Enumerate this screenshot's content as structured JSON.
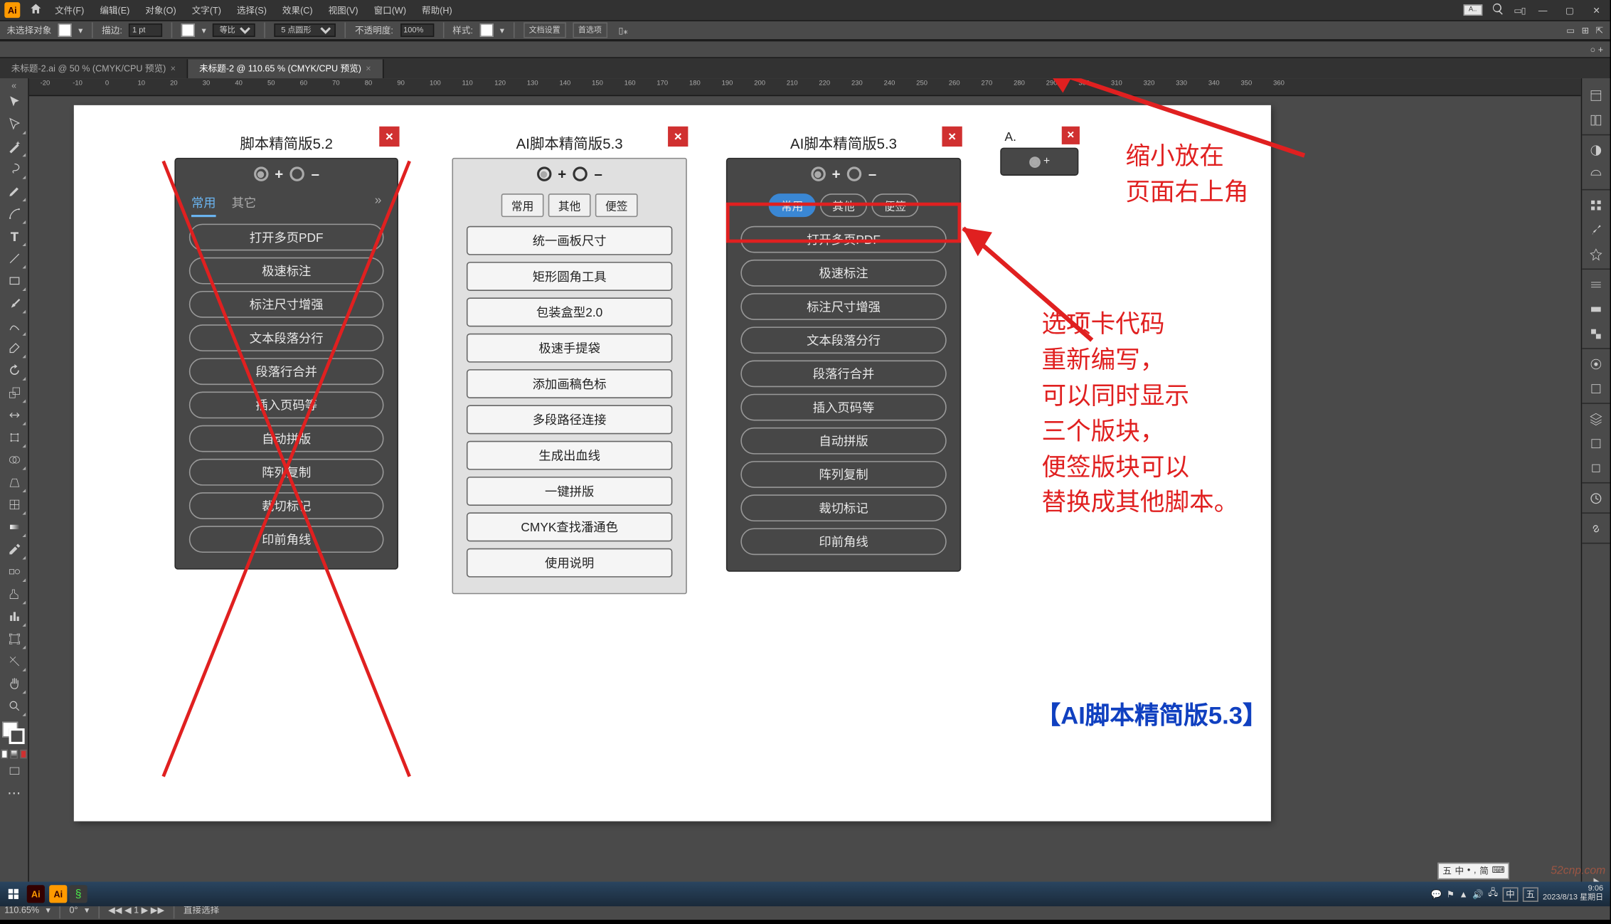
{
  "menu": [
    "文件(F)",
    "编辑(E)",
    "对象(O)",
    "文字(T)",
    "选择(S)",
    "效果(C)",
    "视图(V)",
    "窗口(W)",
    "帮助(H)"
  ],
  "titleMini": "A..",
  "control": {
    "noSelection": "未选择对象",
    "stroke": "描边:",
    "strokeVal": "1 pt",
    "uniform": "等比",
    "dots": "5 点圆形",
    "opacity": "不透明度:",
    "opacityVal": "100%",
    "style": "样式:",
    "docSetup": "文档设置",
    "prefs": "首选项"
  },
  "tabs": [
    {
      "label": "未标题-2.ai @ 50 % (CMYK/CPU 预览)",
      "active": false
    },
    {
      "label": "未标题-2 @ 110.65 % (CMYK/CPU 预览)",
      "active": true
    }
  ],
  "rulerMarks": [
    -20,
    -10,
    0,
    10,
    20,
    30,
    40,
    50,
    60,
    70,
    80,
    90,
    100,
    110,
    120,
    130,
    140,
    150,
    160,
    170,
    180,
    190,
    200,
    210,
    220,
    230,
    240,
    250,
    260,
    270,
    280,
    290,
    300,
    310,
    320,
    330,
    340,
    350,
    360
  ],
  "panel1": {
    "title": "脚本精简版5.2",
    "tabs": [
      "常用",
      "其它"
    ],
    "buttons": [
      "打开多页PDF",
      "极速标注",
      "标注尺寸增强",
      "文本段落分行",
      "段落行合并",
      "插入页码等",
      "自动拼版",
      "阵列复制",
      "裁切标记",
      "印前角线"
    ]
  },
  "panel2": {
    "title": "AI脚本精简版5.3",
    "tabs": [
      "常用",
      "其他",
      "便签"
    ],
    "buttons": [
      "统一画板尺寸",
      "矩形圆角工具",
      "包装盒型2.0",
      "极速手提袋",
      "添加画稿色标",
      "多段路径连接",
      "生成出血线",
      "一键拼版",
      "CMYK查找潘通色",
      "使用说明"
    ]
  },
  "panel3": {
    "title": "AI脚本精简版5.3",
    "tabs": [
      "常用",
      "其他",
      "便签"
    ],
    "buttons": [
      "打开多页PDF",
      "极速标注",
      "标注尺寸增强",
      "文本段落分行",
      "段落行合并",
      "插入页码等",
      "自动拼版",
      "阵列复制",
      "裁切标记",
      "印前角线"
    ]
  },
  "panel4": {
    "title": "A."
  },
  "anno1": "缩小放在\n页面右上角",
  "anno2": "选项卡代码\n重新编写，\n可以同时显示\n三个版块，\n便签版块可以\n替换成其他脚本。",
  "anno3": "【AI脚本精简版5.3】",
  "status": {
    "zoom": "110.65%",
    "rot": "0°",
    "nav": "1",
    "tool": "直接选择"
  },
  "ime": [
    "五",
    "中",
    "•",
    ",",
    "简",
    "⌨"
  ],
  "taskbar": {
    "time": "9:06",
    "date": "2023/8/13 星期日",
    "tray": [
      "msg",
      "flag",
      "up",
      "vol",
      "net",
      "中",
      "五"
    ]
  },
  "watermark": "52cnp.com"
}
